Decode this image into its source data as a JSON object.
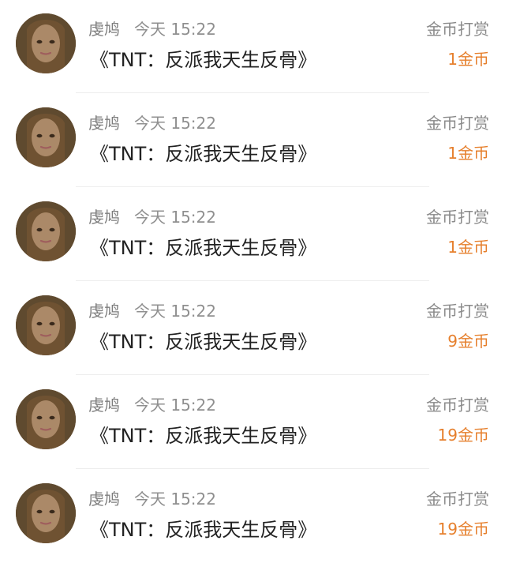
{
  "items": [
    {
      "user": "虔鸠",
      "time": "今天 15:22",
      "title": "《TNT：反派我天生反骨》",
      "type": "金币打赏",
      "amount": "1金币"
    },
    {
      "user": "虔鸠",
      "time": "今天 15:22",
      "title": "《TNT：反派我天生反骨》",
      "type": "金币打赏",
      "amount": "1金币"
    },
    {
      "user": "虔鸠",
      "time": "今天 15:22",
      "title": "《TNT：反派我天生反骨》",
      "type": "金币打赏",
      "amount": "1金币"
    },
    {
      "user": "虔鸠",
      "time": "今天 15:22",
      "title": "《TNT：反派我天生反骨》",
      "type": "金币打赏",
      "amount": "9金币"
    },
    {
      "user": "虔鸠",
      "time": "今天 15:22",
      "title": "《TNT：反派我天生反骨》",
      "type": "金币打赏",
      "amount": "19金币"
    },
    {
      "user": "虔鸠",
      "time": "今天 15:22",
      "title": "《TNT：反派我天生反骨》",
      "type": "金币打赏",
      "amount": "19金币"
    }
  ],
  "colors": {
    "amount": "#e67f2c",
    "meta": "#8a8a8a",
    "title": "#222222"
  }
}
